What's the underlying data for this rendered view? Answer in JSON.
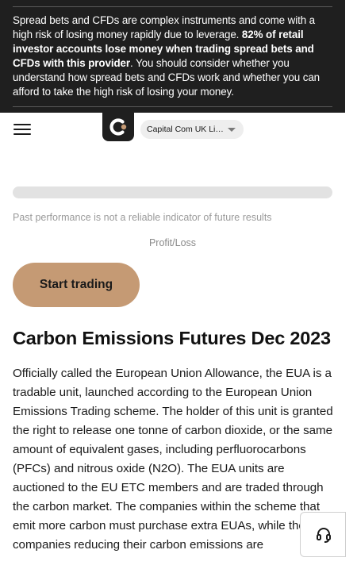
{
  "risk_warning": {
    "part1": "Spread bets and CFDs are complex instruments and come with a high risk of losing money rapidly due to leverage. ",
    "bold": "82% of retail investor accounts lose money when trading spread bets and CFDs with this provider",
    "part2": ". You should consider whether you understand how spread bets and CFDs work and whether you can afford to take the high risk of losing your money."
  },
  "header": {
    "menu_icon": "hamburger-menu-icon",
    "logo_icon": "capital-com-logo-icon",
    "entity_selector": "Capital Com UK Lim..."
  },
  "chart": {
    "disclaimer": "Past performance is not a reliable indicator of future results",
    "pl_label": "Profit/Loss"
  },
  "cta": {
    "label": "Start trading"
  },
  "article": {
    "title": "Carbon Emissions Futures Dec 2023",
    "body": "Officially called the European Union Allowance, the EUA is a tradable unit, launched according to the European Union Emissions Trading scheme. The holder of this unit is granted the right to release one tonne of carbon dioxide, or the same amount of equivalent gases, including perfluorocarbons (PFCs) and nitrous oxide (N2O). The EUA units are auctioned to the EU ETC members and are traded through the carbon market. The companies within the scheme that emit more carbon must purchase extra EUAs, while the companies reducing their carbon emissions are"
  },
  "support": {
    "icon": "headset-support-icon"
  },
  "colors": {
    "banner_bg": "#1f1f1f",
    "cta_bg": "#c59a74",
    "logo_accent": "#c59a74"
  }
}
